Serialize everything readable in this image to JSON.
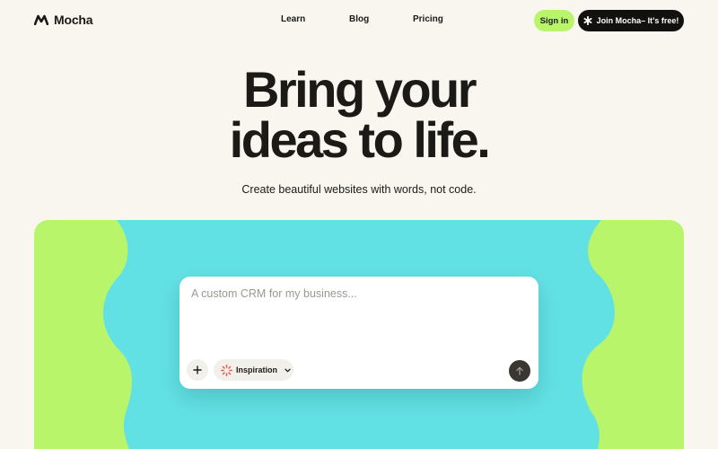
{
  "brand": {
    "name": "Mocha",
    "logo_icon": "mocha-wave-logo"
  },
  "nav": {
    "items": [
      "Learn",
      "Blog",
      "Pricing"
    ]
  },
  "header": {
    "signin_label": "Sign in",
    "join_label": "Join Mocha– It’s free!",
    "join_icon": "asterisk-icon"
  },
  "hero": {
    "title_line1": "Bring your",
    "title_line2": "ideas to life.",
    "subtitle": "Create beautiful websites with words, not code."
  },
  "prompt": {
    "placeholder": "A custom CRM for my business...",
    "inspiration_label": "Inspiration",
    "icons": [
      "plus-icon",
      "sparkle-burst-icon",
      "chevron-down-icon",
      "arrow-up-icon"
    ]
  },
  "colors": {
    "background": "#f8f6ee",
    "lime": "#b8f56a",
    "cyan": "#62e1e4",
    "dark": "#121110",
    "send_button": "#3a3631"
  }
}
